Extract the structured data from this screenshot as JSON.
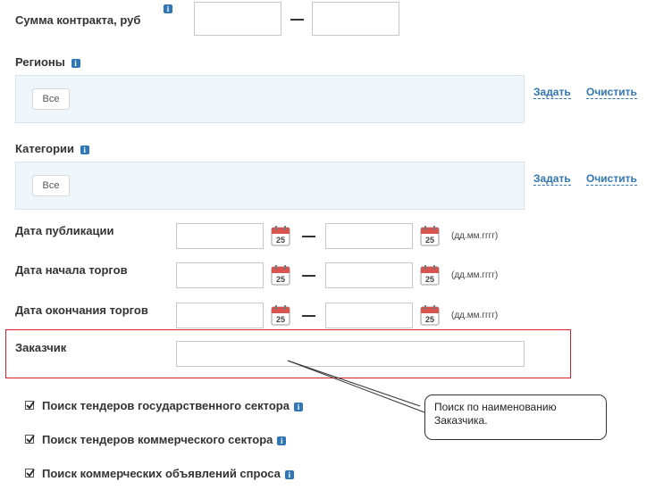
{
  "contract_sum": {
    "label": "Сумма контракта, руб",
    "from_value": "",
    "to_value": ""
  },
  "regions": {
    "label": "Регионы",
    "tag": "Все",
    "set_link": "Задать",
    "clear_link": "Очистить"
  },
  "categories": {
    "label": "Категории",
    "tag": "Все",
    "set_link": "Задать",
    "clear_link": "Очистить"
  },
  "date_fields": [
    {
      "label": "Дата публикации",
      "from_value": "",
      "to_value": "",
      "hint": "(дд.мм.гггг)",
      "cal_day": "25"
    },
    {
      "label": "Дата начала торгов",
      "from_value": "",
      "to_value": "",
      "hint": "(дд.мм.гггг)",
      "cal_day": "25"
    },
    {
      "label": "Дата окончания торгов",
      "from_value": "",
      "to_value": "",
      "hint": "(дд.мм.гггг)",
      "cal_day": "25"
    }
  ],
  "customer": {
    "label": "Заказчик",
    "value": ""
  },
  "callout": {
    "text": "Поиск по наименованию Заказчика."
  },
  "checkboxes": [
    {
      "label": "Поиск тендеров государственного сектора",
      "checked": true
    },
    {
      "label": "Поиск тендеров коммерческого сектора",
      "checked": true
    },
    {
      "label": "Поиск коммерческих объявлений спроса",
      "checked": true
    }
  ],
  "colors": {
    "link": "#2f76b6",
    "info_icon": "#2f76b6",
    "highlight_border": "#d81f26",
    "region_bg": "#eef5fb",
    "calendar_red": "#d9534f"
  },
  "icons": {
    "info": "info-icon",
    "calendar": "calendar-icon",
    "checkmark": "checkmark-icon"
  }
}
